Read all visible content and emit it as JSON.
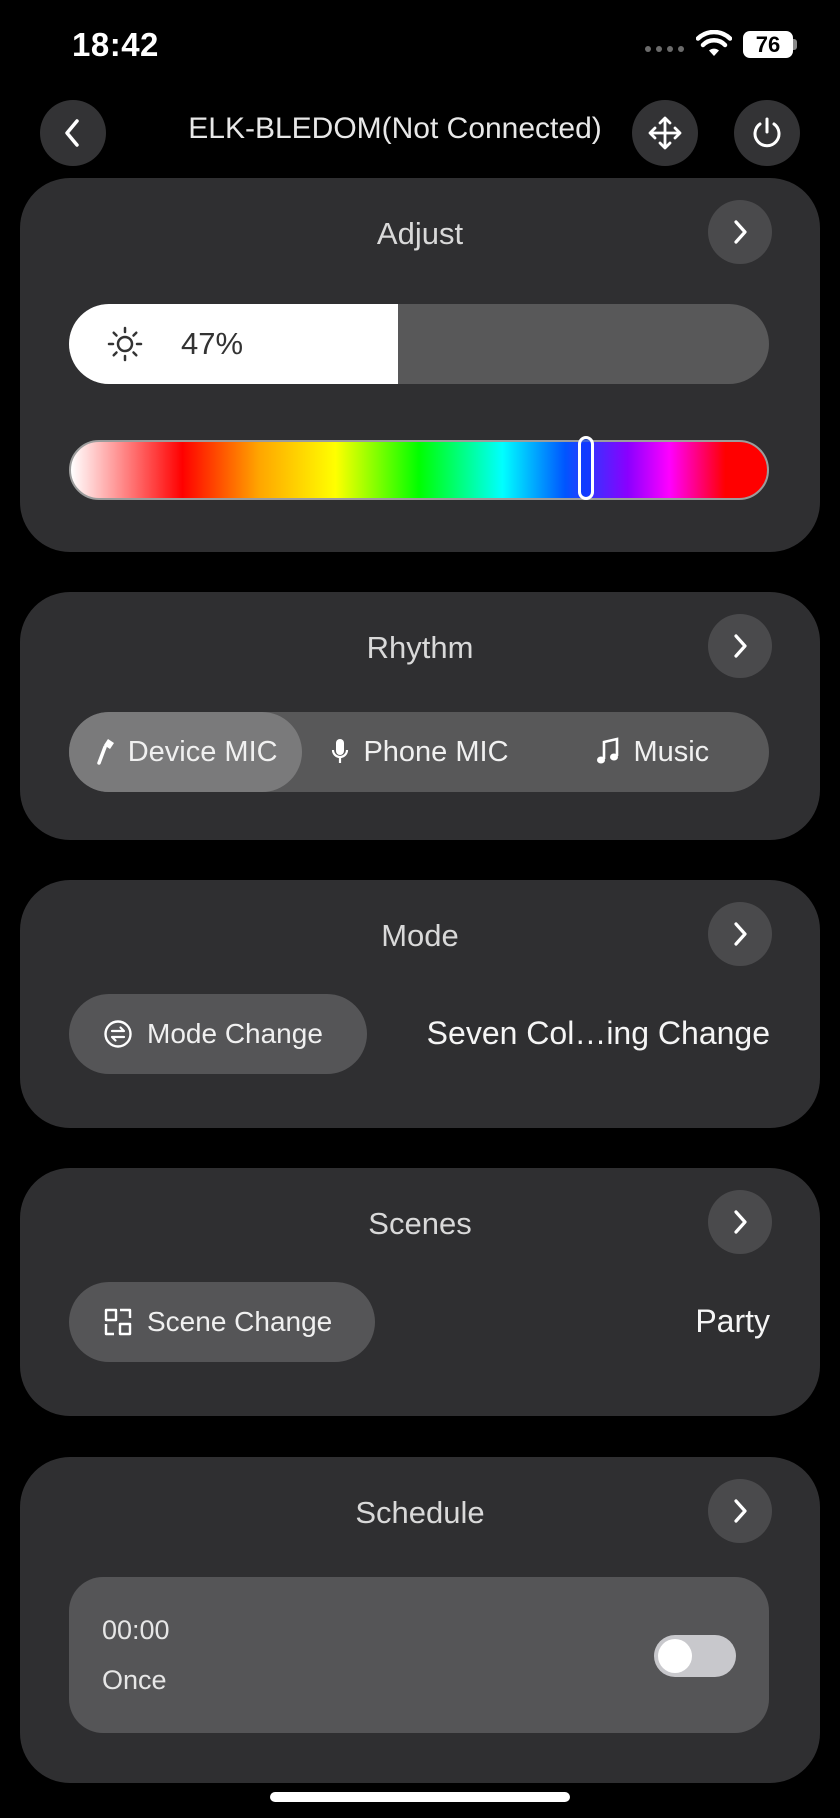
{
  "status_bar": {
    "time": "18:42",
    "battery": "76"
  },
  "header": {
    "title": "ELK-BLEDOM(Not Connected)"
  },
  "adjust": {
    "title": "Adjust",
    "brightness_label": "47%",
    "brightness_fraction": 0.47,
    "hue_position_fraction": 0.74
  },
  "rhythm": {
    "title": "Rhythm",
    "options": [
      "Device MIC",
      "Phone MIC",
      "Music"
    ],
    "selected": "Device MIC"
  },
  "mode": {
    "title": "Mode",
    "button_label": "Mode Change",
    "current": "Seven Col…ing Change"
  },
  "scenes": {
    "title": "Scenes",
    "button_label": "Scene Change",
    "current": "Party"
  },
  "schedule": {
    "title": "Schedule",
    "time": "00:00",
    "repeat": "Once",
    "enabled": false
  }
}
